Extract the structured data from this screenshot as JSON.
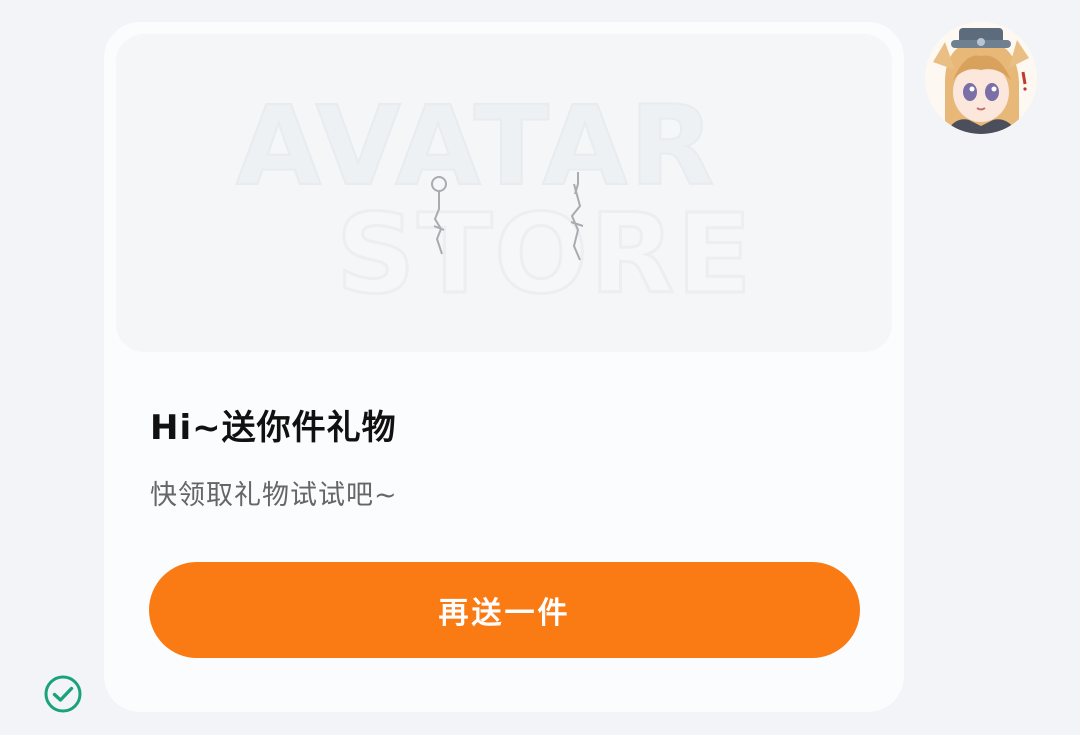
{
  "gift_card": {
    "banner_text_line1": "AVATAR",
    "banner_text_line2": "STORE",
    "title": "Hi~送你件礼物",
    "subtitle": "快领取礼物试试吧~",
    "button_label": "再送一件"
  },
  "avatar": {
    "icon": "anime-girl-avatar"
  },
  "status": {
    "icon": "sent-check-icon"
  },
  "colors": {
    "accent": "#fa7a13",
    "page_background": "#f2f4f7",
    "card_background": "#fbfcfd",
    "check": "#1aa37a"
  }
}
